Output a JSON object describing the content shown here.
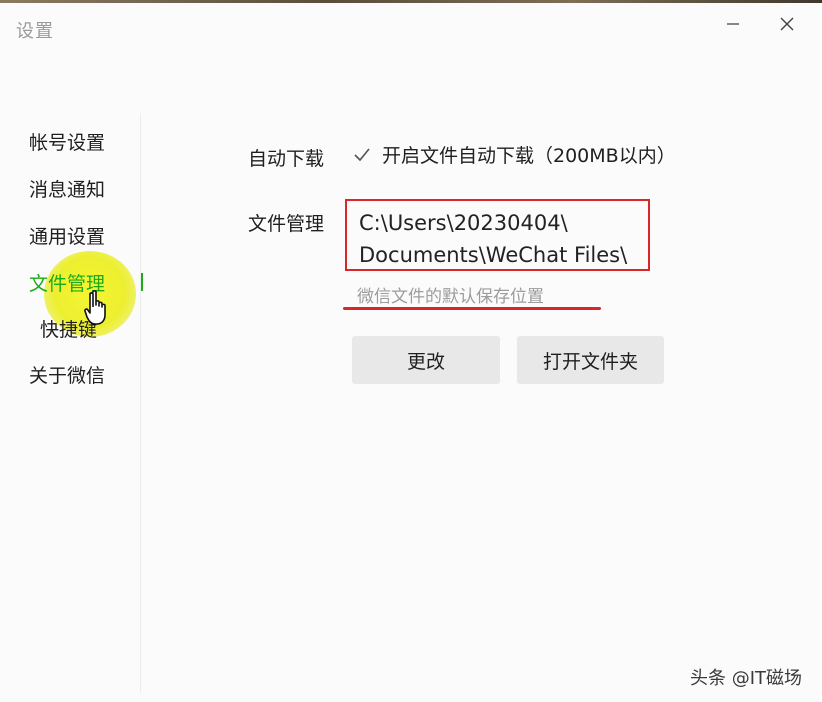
{
  "window": {
    "title": "设置"
  },
  "sidebar": {
    "items": [
      {
        "label": "帐号设置",
        "active": false
      },
      {
        "label": "消息通知",
        "active": false
      },
      {
        "label": "通用设置",
        "active": false
      },
      {
        "label": "文件管理",
        "active": true
      },
      {
        "label": "快捷键",
        "active": false
      },
      {
        "label": "关于微信",
        "active": false
      }
    ]
  },
  "main": {
    "auto_download": {
      "label": "自动下载",
      "checkbox_checked": true,
      "checkbox_label": "开启文件自动下载（200MB以内）"
    },
    "file_management": {
      "label": "文件管理",
      "path_line1": "C:\\Users\\20230404\\",
      "path_line2": "Documents\\WeChat Files\\",
      "note": "微信文件的默认保存位置"
    },
    "buttons": {
      "change": "更改",
      "open_folder": "打开文件夹"
    }
  },
  "watermark": "头条 @IT磁场",
  "colors": {
    "accent": "#1aad19",
    "annotation_red": "#d9262b",
    "highlight_yellow": "#f3f32a",
    "button_bg": "#e8e8e8"
  },
  "icons": {
    "minimize": "minimize-icon",
    "close": "close-icon",
    "check": "check-icon",
    "cursor": "hand-pointer-icon"
  }
}
